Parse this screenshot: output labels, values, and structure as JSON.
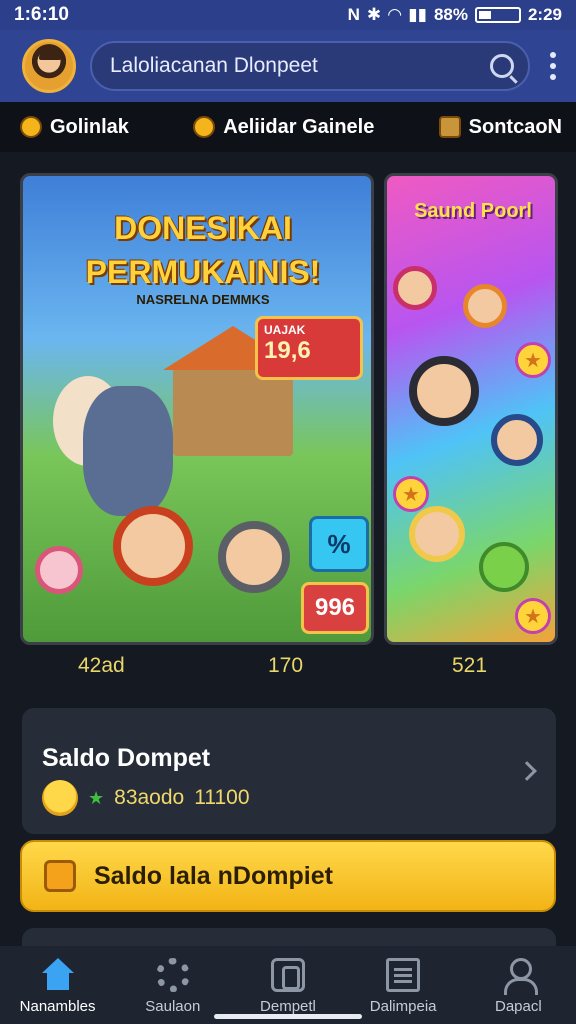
{
  "status_bar": {
    "time": "1:6:10",
    "battery_text": "88%",
    "clock_right": "2:29"
  },
  "header": {
    "search_text": "Laloliacanan Dlonpeet"
  },
  "categories": [
    {
      "label": "Golinlak",
      "icon": "coin-icon"
    },
    {
      "label": "Aeliidar Gainele",
      "icon": "coin-icon"
    },
    {
      "label": "SontcaoN",
      "icon": "chest-icon"
    }
  ],
  "banner1": {
    "title_line1": "DONESIKAI",
    "title_line2": "PERMUKAINIS!",
    "subtitle": "NASRELNA DEMMKS",
    "badge_label": "UAJAK",
    "badge_value": "19,6",
    "chip_percent": "%",
    "chip_value": "996"
  },
  "banner2": {
    "title": "Saund Poorl"
  },
  "counts": {
    "left": "42ad",
    "middle": "170",
    "right": "521"
  },
  "wallet": {
    "title": "Saldo Dompet",
    "balance_label": "83aodo",
    "balance_value": "11100"
  },
  "cta": {
    "label": "Saldo lala nDompiet"
  },
  "nav": [
    {
      "label": "Nanambles",
      "icon": "home-icon",
      "active": true
    },
    {
      "label": "Saulaon",
      "icon": "gear-icon"
    },
    {
      "label": "Dempetl",
      "icon": "wallet-icon"
    },
    {
      "label": "Dalimpeia",
      "icon": "list-icon"
    },
    {
      "label": "Dapacl",
      "icon": "user-icon"
    }
  ],
  "colors": {
    "header_bg": "#2f4594",
    "accent_yellow": "#f2b416",
    "page_bg": "#151a22",
    "nav_active": "#3aa3f2"
  }
}
